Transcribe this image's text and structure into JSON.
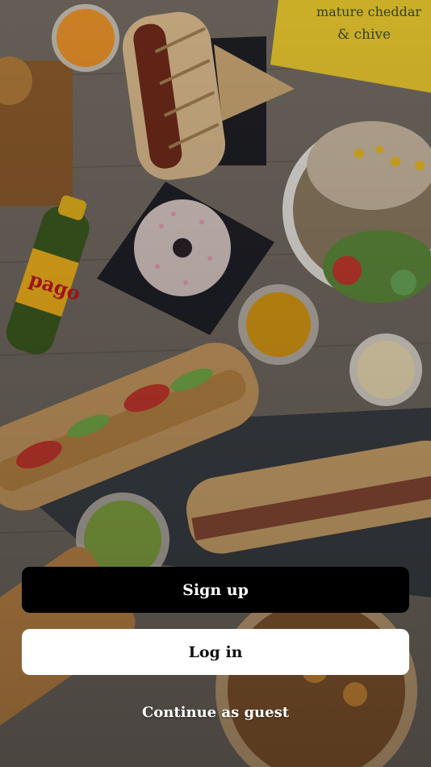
{
  "background": {
    "description_icon": "food-spread-image",
    "chips_bag_text": [
      "mature cheddar",
      "& chive"
    ],
    "juice_brand": "pago"
  },
  "actions": {
    "signup_label": "Sign up",
    "login_label": "Log in",
    "guest_label": "Continue as guest"
  },
  "colors": {
    "primary_button": "#000000",
    "secondary_button": "#ffffff"
  }
}
